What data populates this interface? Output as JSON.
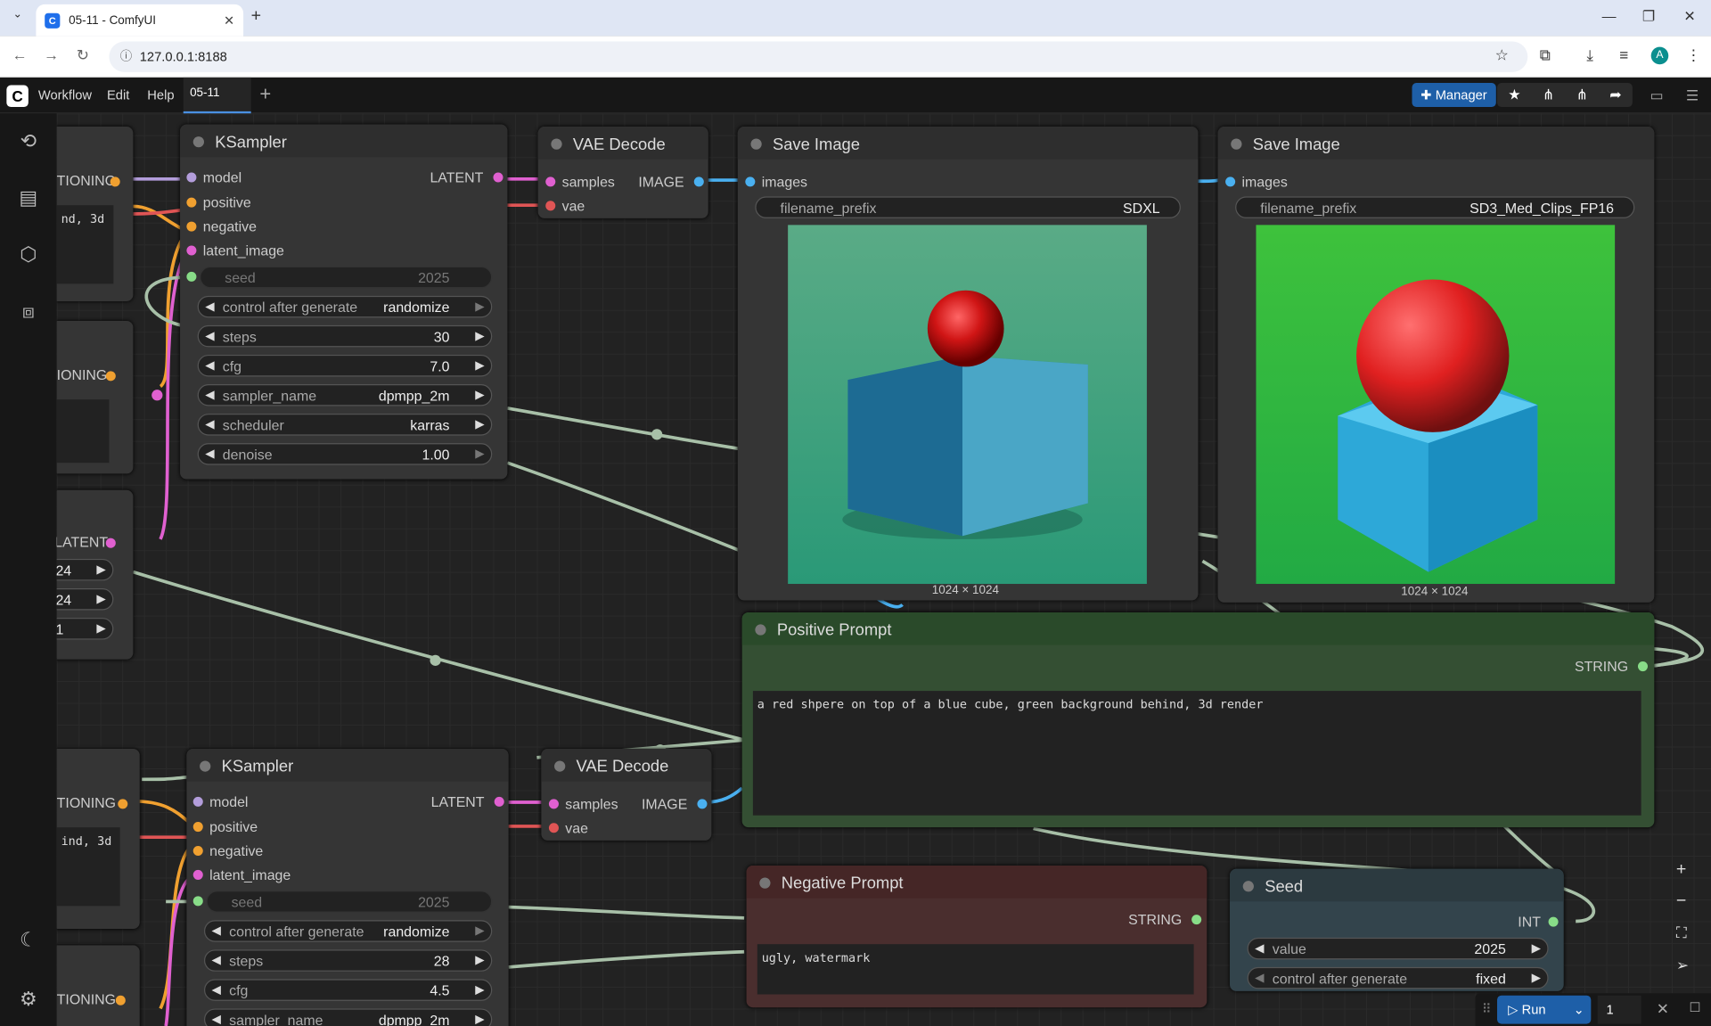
{
  "browser": {
    "tab_title": "05-11 - ComfyUI",
    "url": "127.0.0.1:8188",
    "avatar_letter": "A"
  },
  "menubar": {
    "items": [
      "Workflow",
      "Edit",
      "Help"
    ],
    "workflow_tab": "05-11",
    "manager_label": "Manager"
  },
  "nodes": {
    "ksampler1": {
      "title": "KSampler",
      "inputs": [
        "model",
        "positive",
        "negative",
        "latent_image"
      ],
      "output": "LATENT",
      "seed": {
        "label": "seed",
        "value": "2025"
      },
      "control": {
        "label": "control after generate",
        "value": "randomize"
      },
      "steps": {
        "label": "steps",
        "value": "30"
      },
      "cfg": {
        "label": "cfg",
        "value": "7.0"
      },
      "sampler": {
        "label": "sampler_name",
        "value": "dpmpp_2m"
      },
      "scheduler": {
        "label": "scheduler",
        "value": "karras"
      },
      "denoise": {
        "label": "denoise",
        "value": "1.00"
      }
    },
    "vae1": {
      "title": "VAE Decode",
      "inputs": [
        "samples",
        "vae"
      ],
      "output": "IMAGE"
    },
    "save1": {
      "title": "Save Image",
      "input": "images",
      "prefix_label": "filename_prefix",
      "prefix_value": "SDXL",
      "dims": "1024 × 1024"
    },
    "save2": {
      "title": "Save Image",
      "input": "images",
      "prefix_label": "filename_prefix",
      "prefix_value": "SD3_Med_Clips_FP16",
      "dims": "1024 × 1024"
    },
    "positive": {
      "title": "Positive Prompt",
      "output": "STRING",
      "text": "a red shpere on top of a blue cube, green background behind, 3d render"
    },
    "negative": {
      "title": "Negative Prompt",
      "output": "STRING",
      "text": "ugly, watermark"
    },
    "seed": {
      "title": "Seed",
      "output": "INT",
      "value_label": "value",
      "value": "2025",
      "control_label": "control after generate",
      "control_value": "fixed"
    },
    "ksampler2": {
      "title": "KSampler",
      "inputs": [
        "model",
        "positive",
        "negative",
        "latent_image"
      ],
      "output": "LATENT",
      "seed": {
        "label": "seed",
        "value": "2025"
      },
      "control": {
        "label": "control after generate",
        "value": "randomize"
      },
      "steps": {
        "label": "steps",
        "value": "28"
      },
      "cfg": {
        "label": "cfg",
        "value": "4.5"
      },
      "sampler": {
        "label": "sampler_name",
        "value": "dpmpp_2m"
      }
    },
    "vae2": {
      "title": "VAE Decode",
      "inputs": [
        "samples",
        "vae"
      ],
      "output": "IMAGE"
    },
    "left": {
      "cond1": "TIONING",
      "text1": "nd, 3d",
      "cond2": "IONING",
      "latent": "LATENT",
      "w1": "24",
      "w2": "24",
      "w3": "1",
      "cond3": "TIONING",
      "text2": "ind, 3d",
      "cond4": "TIONING"
    }
  },
  "runbar": {
    "run_label": "Run",
    "count": "1"
  }
}
